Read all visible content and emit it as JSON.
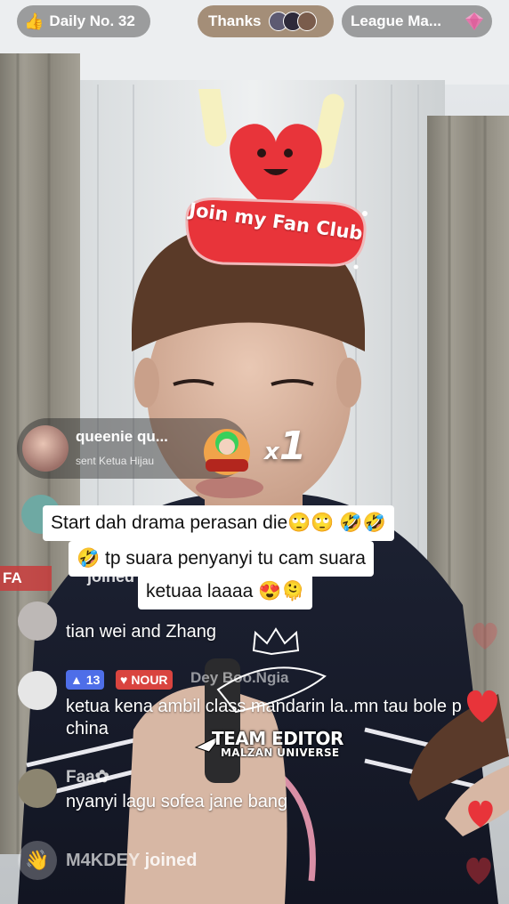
{
  "top_bar": {
    "daily_label": "Daily No. 32",
    "daily_icon": "thumbs-up-icon",
    "thanks_label": "Thanks",
    "league_label": "League Ma...",
    "league_icon": "gem-icon"
  },
  "effects": {
    "fan_club_label": "Join my Fan Club"
  },
  "gift": {
    "username": "queenie qu...",
    "sent_text": "sent Ketua Hijau",
    "count_prefix": "x",
    "count": "1"
  },
  "caption": {
    "line1": "Start dah drama perasan die🙄🙄 🤣🤣",
    "line2": "🤣 tp suara penyanyi tu cam suara",
    "line3": "ketuaa laaaa 😍🫠"
  },
  "fan_tag": "FA",
  "partial_joined": "joined",
  "comments": [
    {
      "username": "",
      "text": "tian wei  and Zhang"
    },
    {
      "level": "13",
      "badge_name": "NOUR",
      "username": "Dey Boo.Ngia",
      "text": "ketua kena ambil class mandarin la..mn tau bole p china"
    },
    {
      "username": "Faa✿",
      "text": "nyanyi lagu sofea jane bang"
    }
  ],
  "join_message": {
    "username": "M4KDEY",
    "action": "joined"
  },
  "watermark": {
    "title": "TEAM EDITOR",
    "subtitle": "MALZAN UNIVERSE"
  },
  "colors": {
    "heart_red": "#e8343a",
    "badge_blue": "#4e6ee8",
    "badge_red": "#d9443f",
    "thanks_pill": "#8c6e50"
  }
}
